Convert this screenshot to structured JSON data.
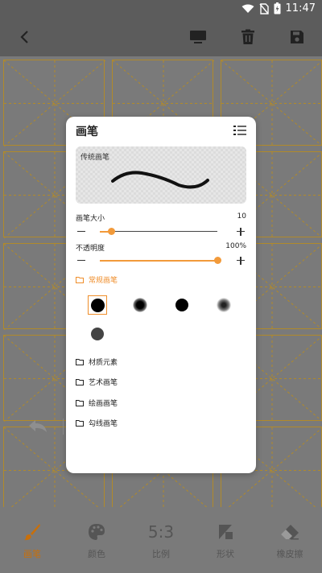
{
  "status_bar": {
    "time": "11:47",
    "icons": [
      "wifi-icon",
      "no-sim-icon",
      "battery-icon"
    ]
  },
  "app_bar": {
    "icons": [
      "back-icon",
      "monitor-icon",
      "trash-icon",
      "save-icon"
    ]
  },
  "brush_panel": {
    "title": "画笔",
    "preview_label": "传统画笔",
    "size_label": "画笔大小",
    "size_value": "10",
    "size_fraction": 0.1,
    "opacity_label": "不透明度",
    "opacity_value": "100%",
    "opacity_fraction": 1.0,
    "categories": [
      {
        "label": "常规画笔",
        "active": true
      },
      {
        "label": "材质元素",
        "active": false
      },
      {
        "label": "艺术画笔",
        "active": false
      },
      {
        "label": "绘画画笔",
        "active": false
      },
      {
        "label": "勾线画笔",
        "active": false
      }
    ],
    "brush_tips": [
      "solid-round",
      "soft-round",
      "ink-round",
      "blur-round",
      "gray-round"
    ],
    "selected_tip": 0
  },
  "bottom_tabs": [
    {
      "label": "画笔",
      "icon": "brush-icon",
      "active": true
    },
    {
      "label": "颜色",
      "icon": "palette-icon",
      "active": false
    },
    {
      "label": "比例",
      "icon": "ratio-icon",
      "text": "5:3",
      "active": false
    },
    {
      "label": "形状",
      "icon": "shape-icon",
      "active": false
    },
    {
      "label": "橡皮擦",
      "icon": "eraser-icon",
      "active": false
    }
  ],
  "colors": {
    "accent": "#ef8e2b",
    "grid_line": "#b18a2a",
    "dim_background": "#7a7a7a"
  }
}
